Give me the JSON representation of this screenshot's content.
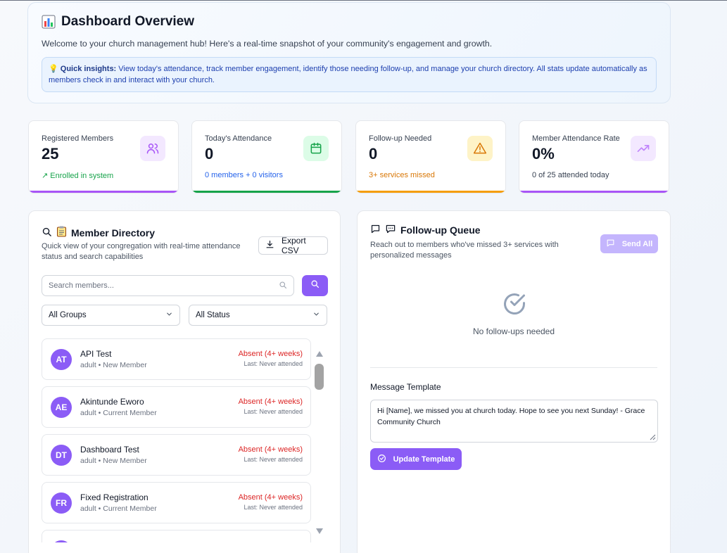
{
  "overview": {
    "title": "Dashboard Overview",
    "subtitle": "Welcome to your church management hub! Here's a real-time snapshot of your community's engagement and growth.",
    "insights_label": "Quick insights:",
    "insights_text": "View today's attendance, track member engagement, identify those needing follow-up, and manage your church directory. All stats update automatically as members check in and interact with your church."
  },
  "stats": [
    {
      "label": "Registered Members",
      "value": "25",
      "foot": "Enrolled in system",
      "icon": "users-icon",
      "accent": "#a855f7",
      "foot_color": "#16a34a"
    },
    {
      "label": "Today's Attendance",
      "value": "0",
      "foot": "0 members + 0 visitors",
      "icon": "calendar-icon",
      "accent": "#16a34a",
      "foot_color": "#2563eb"
    },
    {
      "label": "Follow-up Needed",
      "value": "0",
      "foot": "3+ services missed",
      "icon": "warning-icon",
      "accent": "#f59e0b",
      "foot_color": "#d97706"
    },
    {
      "label": "Member Attendance Rate",
      "value": "0%",
      "foot": "0 of 25 attended today",
      "icon": "trending-up-icon",
      "accent": "#a855f7",
      "foot_color": "#374151"
    }
  ],
  "directory": {
    "title": "Member Directory",
    "subtitle": "Quick view of your congregation with real-time attendance status and search capabilities",
    "export_label": "Export CSV",
    "search_placeholder": "Search members...",
    "group_filter": "All Groups",
    "status_filter": "All Status",
    "members": [
      {
        "initials": "AT",
        "name": "API Test",
        "meta": "adult • New Member",
        "status": "Absent (4+ weeks)",
        "last": "Last: Never attended"
      },
      {
        "initials": "AE",
        "name": "Akintunde Eworo",
        "meta": "adult • Current Member",
        "status": "Absent (4+ weeks)",
        "last": "Last: Never attended"
      },
      {
        "initials": "DT",
        "name": "Dashboard Test",
        "meta": "adult • New Member",
        "status": "Absent (4+ weeks)",
        "last": "Last: Never attended"
      },
      {
        "initials": "FR",
        "name": "Fixed Registration",
        "meta": "adult • Current Member",
        "status": "Absent (4+ weeks)",
        "last": "Last: Never attended"
      }
    ]
  },
  "followup": {
    "title": "Follow-up Queue",
    "subtitle": "Reach out to members who've missed 3+ services with personalized messages",
    "send_all_label": "Send All",
    "empty_text": "No follow-ups needed",
    "template_label": "Message Template",
    "template_text": "Hi [Name], we missed you at church today. Hope to see you next Sunday! - Grace Community Church",
    "update_label": "Update Template"
  },
  "colors": {
    "primary": "#8b5cf6",
    "danger": "#dc2626"
  }
}
